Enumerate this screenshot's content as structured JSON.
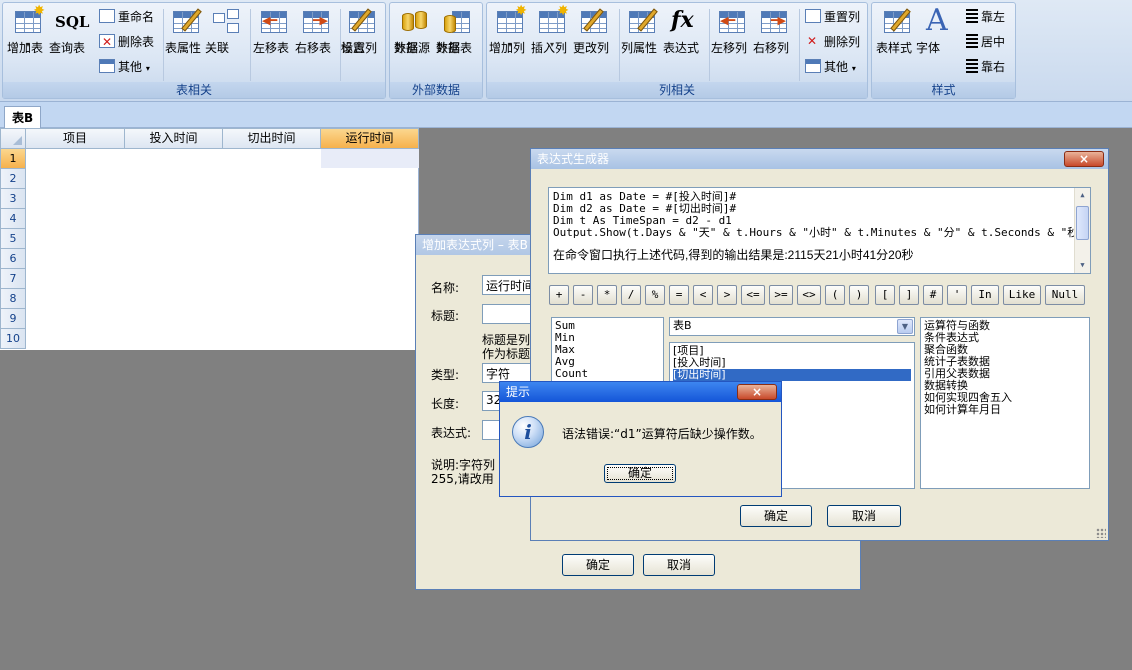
{
  "ribbon": {
    "groups": {
      "table": "表相关",
      "external": "外部数据",
      "column": "列相关",
      "style": "样式"
    },
    "buttons": {
      "add_table": "增加表",
      "query_table": "查询表",
      "rename": "重命名",
      "delete_table": "删除表",
      "other1": "其他",
      "table_props": "表属性",
      "relation": "关联",
      "move_left": "左移表",
      "move_right": "右移表",
      "set_flag_line1": "设置",
      "set_flag_line2": "标志列",
      "ext_source_line1": "外部",
      "ext_source_line2": "数据源",
      "ext_table_line1": "外部",
      "ext_table_line2": "数据表",
      "add_column": "增加列",
      "insert_column": "插入列",
      "modify_column": "更改列",
      "column_props": "列属性",
      "expression": "表达式",
      "col_move_left": "左移列",
      "col_move_right": "右移列",
      "reset_column": "重置列",
      "delete_column": "删除列",
      "other2": "其他",
      "table_style": "表样式",
      "font": "字体",
      "align_left": "靠左",
      "align_center": "居中",
      "align_right": "靠右"
    }
  },
  "tabs": [
    "表B"
  ],
  "grid": {
    "columns": [
      "项目",
      "投入时间",
      "切出时间",
      "运行时间"
    ],
    "rows": [
      "1",
      "2",
      "3",
      "4",
      "5",
      "6",
      "7",
      "8",
      "9",
      "10"
    ]
  },
  "add_window": {
    "title": "增加表达式列 – 表B",
    "name_label": "名称:",
    "name_value": "运行时间",
    "caption_label": "标题:",
    "caption_note_1": "标题是列",
    "caption_note_2": "作为标题",
    "type_label": "类型:",
    "type_value": "字符",
    "length_label": "长度:",
    "length_value": "32",
    "expr_label": "表达式:",
    "desc_1": "说明:字符列",
    "desc_2": "255,请改用",
    "ok": "确定",
    "cancel": "取消"
  },
  "expr_window": {
    "title": "表达式生成器",
    "code": [
      "Dim d1 as Date = #[投入时间]#",
      "Dim d2 as Date = #[切出时间]#",
      "Dim t As TimeSpan = d2 - d1",
      "Output.Show(t.Days & \"天\" & t.Hours & \"小时\" & t.Minutes & \"分\" & t.Seconds & \"秒\")"
    ],
    "result": "在命令窗口执行上述代码,得到的输出结果是:2115天21小时41分20秒",
    "operators": [
      "+",
      "-",
      "*",
      "/",
      "%",
      "=",
      "<",
      ">",
      "<=",
      ">=",
      "<>",
      "(",
      ")",
      "[",
      "]",
      "#",
      "'",
      "In",
      "Like",
      "Null"
    ],
    "functions": [
      "Sum",
      "Min",
      "Max",
      "Avg",
      "Count"
    ],
    "table_select": "表B",
    "fields": [
      "[项目]",
      "[投入时间]",
      "[切出时间]"
    ],
    "help_topics": [
      "运算符与函数",
      "条件表达式",
      "聚合函数",
      "统计子表数据",
      "引用父表数据",
      "数据转换",
      "如何实现四舍五入",
      "如何计算年月日"
    ],
    "ok": "确定",
    "cancel": "取消"
  },
  "tip": {
    "title": "提示",
    "message": "语法错误:“d1”运算符后缺少操作数。",
    "ok": "确定"
  },
  "icons": {
    "close": "×",
    "info": "i"
  }
}
